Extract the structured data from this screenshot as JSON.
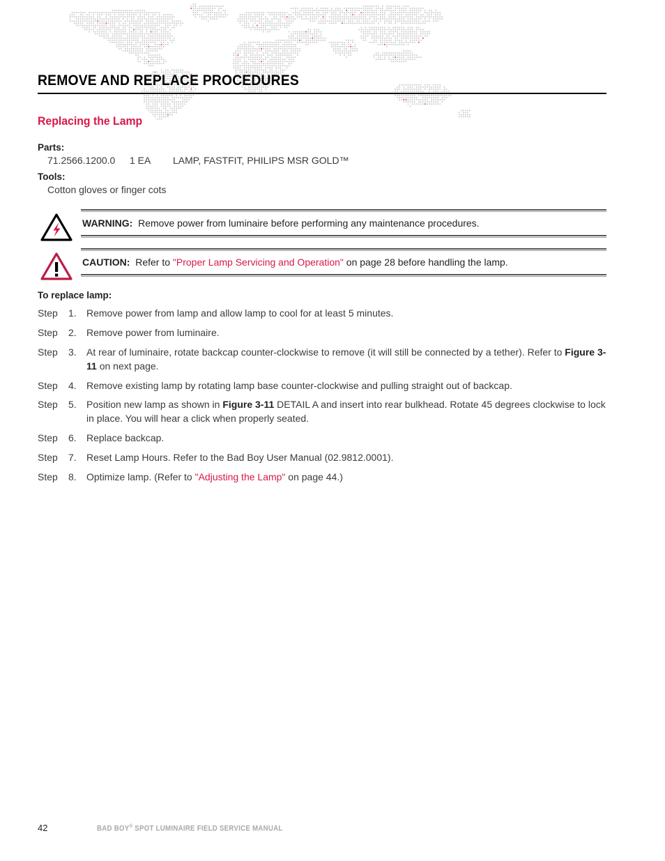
{
  "document": {
    "chapter_title": "REMOVE AND REPLACE PROCEDURES",
    "section_heading": "Replacing the Lamp"
  },
  "parts": {
    "label": "Parts:",
    "part_number": "71.2566.1200.0",
    "quantity": "1 EA",
    "description": "LAMP, FASTFIT, PHILIPS MSR GOLD™"
  },
  "tools": {
    "label": "Tools:",
    "items": [
      "Cotton gloves or finger cots"
    ]
  },
  "admonitions": [
    {
      "icon": "warning-lightning-triangle-icon",
      "keyword": "WARNING:",
      "text": "Remove power from luminaire before performing any maintenance procedures.",
      "link_text": "",
      "text_after_link": ""
    },
    {
      "icon": "caution-exclamation-triangle-icon",
      "keyword": "CAUTION:",
      "text": "Refer to ",
      "link_text": "\"Proper Lamp Servicing and Operation\"",
      "text_after_link": " on page 28 before handling the lamp."
    }
  ],
  "procedure": {
    "heading": "To replace lamp:",
    "step_word": "Step",
    "steps": [
      {
        "number": "1.",
        "segments": [
          {
            "text": "Remove power from lamp and allow lamp to cool for at least 5 minutes.",
            "style": "normal"
          }
        ]
      },
      {
        "number": "2.",
        "segments": [
          {
            "text": "Remove power from luminaire.",
            "style": "normal"
          }
        ]
      },
      {
        "number": "3.",
        "segments": [
          {
            "text": "At rear of luminaire, rotate backcap counter-clockwise to remove (it will still be connected by a tether). Refer to ",
            "style": "normal"
          },
          {
            "text": "Figure 3-11",
            "style": "bold"
          },
          {
            "text": " on next page.",
            "style": "normal"
          }
        ]
      },
      {
        "number": "4.",
        "segments": [
          {
            "text": "Remove existing lamp by rotating lamp base counter-clockwise and pulling straight out of backcap.",
            "style": "normal"
          }
        ]
      },
      {
        "number": "5.",
        "segments": [
          {
            "text": "Position new lamp as shown in ",
            "style": "normal"
          },
          {
            "text": "Figure 3-11",
            "style": "bold"
          },
          {
            "text": " DETAIL A and insert into rear bulkhead. Rotate 45 degrees clockwise to lock in place. You will hear a click when properly seated.",
            "style": "normal"
          }
        ]
      },
      {
        "number": "6.",
        "segments": [
          {
            "text": "Replace backcap.",
            "style": "normal"
          }
        ]
      },
      {
        "number": "7.",
        "segments": [
          {
            "text": "Reset Lamp Hours. Refer to the Bad Boy User Manual (02.9812.0001).",
            "style": "normal"
          }
        ]
      },
      {
        "number": "8.",
        "segments": [
          {
            "text": "Optimize lamp. (Refer to ",
            "style": "normal"
          },
          {
            "text": "\"Adjusting the Lamp\"",
            "style": "link"
          },
          {
            "text": " on page 44.)",
            "style": "normal"
          }
        ]
      }
    ]
  },
  "footer": {
    "page_number": "42",
    "manual_title_prefix": "BAD BOY",
    "manual_title_sup": "®",
    "manual_title_suffix": " SPOT LUMINAIRE FIELD SERVICE MANUAL"
  },
  "colors": {
    "accent_red": "#d6194a",
    "body_text": "#3b3b3b",
    "heading_black": "#000000",
    "footer_gray": "#a7a9ac",
    "map_dot_gray": "#c9c9cb",
    "map_dot_red": "#e03a52"
  }
}
